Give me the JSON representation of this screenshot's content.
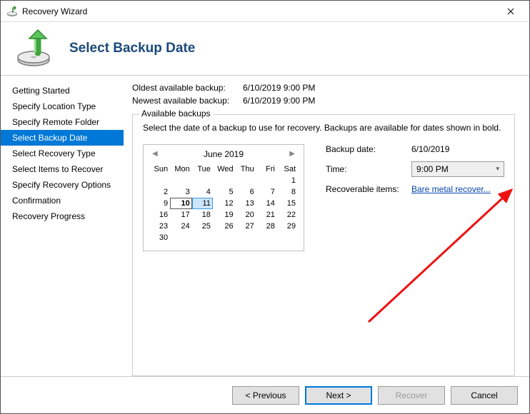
{
  "window": {
    "title": "Recovery Wizard"
  },
  "header": {
    "title": "Select Backup Date"
  },
  "sidebar": {
    "items": [
      {
        "label": "Getting Started"
      },
      {
        "label": "Specify Location Type"
      },
      {
        "label": "Specify Remote Folder"
      },
      {
        "label": "Select Backup Date"
      },
      {
        "label": "Select Recovery Type"
      },
      {
        "label": "Select Items to Recover"
      },
      {
        "label": "Specify Recovery Options"
      },
      {
        "label": "Confirmation"
      },
      {
        "label": "Recovery Progress"
      }
    ],
    "selected_index": 3
  },
  "info": {
    "oldest_label": "Oldest available backup:",
    "oldest_value": "6/10/2019 9:00 PM",
    "newest_label": "Newest available backup:",
    "newest_value": "6/10/2019 9:00 PM"
  },
  "group": {
    "title": "Available backups",
    "description": "Select the date of a backup to use for recovery. Backups are available for dates shown in bold."
  },
  "calendar": {
    "month_label": "June 2019",
    "day_headers": [
      "Sun",
      "Mon",
      "Tue",
      "Wed",
      "Thu",
      "Fri",
      "Sat"
    ],
    "weeks": [
      [
        "",
        "",
        "",
        "",
        "",
        "",
        "1"
      ],
      [
        "2",
        "3",
        "4",
        "5",
        "6",
        "7",
        "8"
      ],
      [
        "9",
        "10",
        "11",
        "12",
        "13",
        "14",
        "15"
      ],
      [
        "16",
        "17",
        "18",
        "19",
        "20",
        "21",
        "22"
      ],
      [
        "23",
        "24",
        "25",
        "26",
        "27",
        "28",
        "29"
      ],
      [
        "30",
        "",
        "",
        "",
        "",
        "",
        ""
      ]
    ],
    "today_day": "10",
    "selected_day": "11",
    "bold_days": [
      "10"
    ]
  },
  "details": {
    "backup_date_label": "Backup date:",
    "backup_date_value": "6/10/2019",
    "time_label": "Time:",
    "time_value": "9:00 PM",
    "recoverable_label": "Recoverable items:",
    "recoverable_link": "Bare metal recover..."
  },
  "footer": {
    "previous": "< Previous",
    "next": "Next >",
    "recover": "Recover",
    "cancel": "Cancel"
  }
}
